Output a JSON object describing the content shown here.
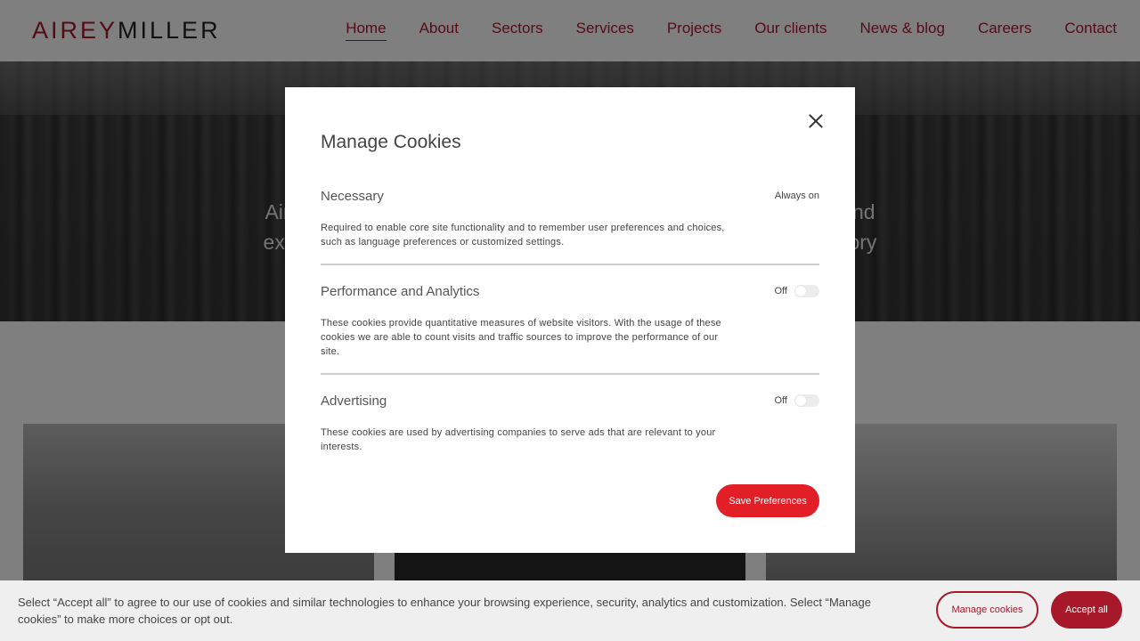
{
  "colors": {
    "brand": "#a8182b",
    "save_button": "#e21f26",
    "overlay": "rgba(0,0,0,0.5)"
  },
  "header": {
    "logo": {
      "part_a": "AIREY",
      "part_b": "MILLER"
    },
    "nav": [
      {
        "label": "Home",
        "active": true
      },
      {
        "label": "About"
      },
      {
        "label": "Sectors"
      },
      {
        "label": "Services"
      },
      {
        "label": "Projects"
      },
      {
        "label": "Our clients"
      },
      {
        "label": "News & blog"
      },
      {
        "label": "Careers"
      },
      {
        "label": "Contact"
      }
    ]
  },
  "hero": {
    "text_line_1": "Airey                                                                                          o end",
    "text_line_2": "exper                                                                                          latory"
  },
  "modal": {
    "title": "Manage Cookies",
    "close_icon": "close-icon",
    "sections": [
      {
        "title": "Necessary",
        "status": "Always on",
        "description": "Required to enable core site functionality and to remember user preferences and choices, such as language preferences or customized settings."
      },
      {
        "title": "Performance and Analytics",
        "status": "Off",
        "description": "These cookies provide quantitative measures of website visitors. With the usage of these cookies we are able to count visits and traffic sources to improve the performance of our site."
      },
      {
        "title": "Advertising",
        "status": "Off",
        "description": "These cookies are used by advertising companies to serve ads that are relevant to your interests."
      }
    ],
    "save_label": "Save Preferences"
  },
  "cookie_bar": {
    "text": "Select “Accept all” to agree to our use of cookies and similar technologies to enhance your browsing experience, security, analytics and customization. Select “Manage cookies” to make more choices or opt out.",
    "manage_label": "Manage cookies",
    "accept_label": "Accept all"
  }
}
